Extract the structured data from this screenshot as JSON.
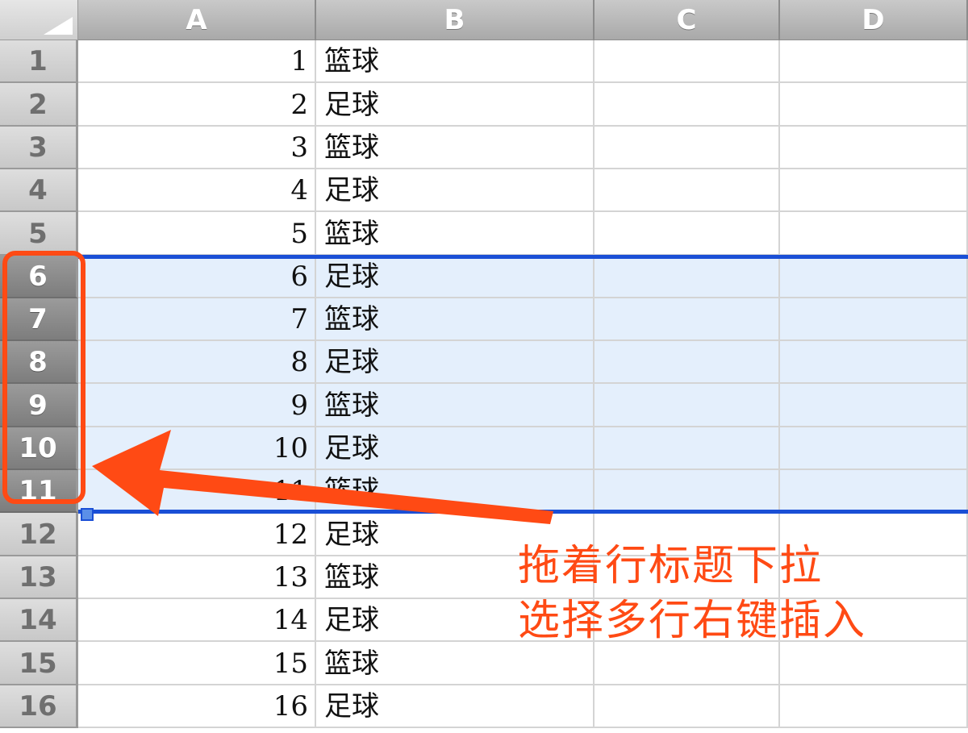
{
  "columns": [
    "A",
    "B",
    "C",
    "D"
  ],
  "rows": [
    {
      "n": "1",
      "a": "1",
      "b": "篮球"
    },
    {
      "n": "2",
      "a": "2",
      "b": "足球"
    },
    {
      "n": "3",
      "a": "3",
      "b": "篮球"
    },
    {
      "n": "4",
      "a": "4",
      "b": "足球"
    },
    {
      "n": "5",
      "a": "5",
      "b": "篮球"
    },
    {
      "n": "6",
      "a": "6",
      "b": "足球"
    },
    {
      "n": "7",
      "a": "7",
      "b": "篮球"
    },
    {
      "n": "8",
      "a": "8",
      "b": "足球"
    },
    {
      "n": "9",
      "a": "9",
      "b": "篮球"
    },
    {
      "n": "10",
      "a": "10",
      "b": "足球"
    },
    {
      "n": "11",
      "a": "11",
      "b": "篮球"
    },
    {
      "n": "12",
      "a": "12",
      "b": "足球"
    },
    {
      "n": "13",
      "a": "13",
      "b": "篮球"
    },
    {
      "n": "14",
      "a": "14",
      "b": "足球"
    },
    {
      "n": "15",
      "a": "15",
      "b": "篮球"
    },
    {
      "n": "16",
      "a": "16",
      "b": "足球"
    }
  ],
  "selected_rows": [
    "6",
    "7",
    "8",
    "9",
    "10",
    "11"
  ],
  "annotation": {
    "line1": "拖着行标题下拉",
    "line2": "选择多行右键插入",
    "color": "#ff4a14"
  },
  "colors": {
    "selection_border": "#1a4fd6",
    "selection_fill": "#e4effc"
  }
}
